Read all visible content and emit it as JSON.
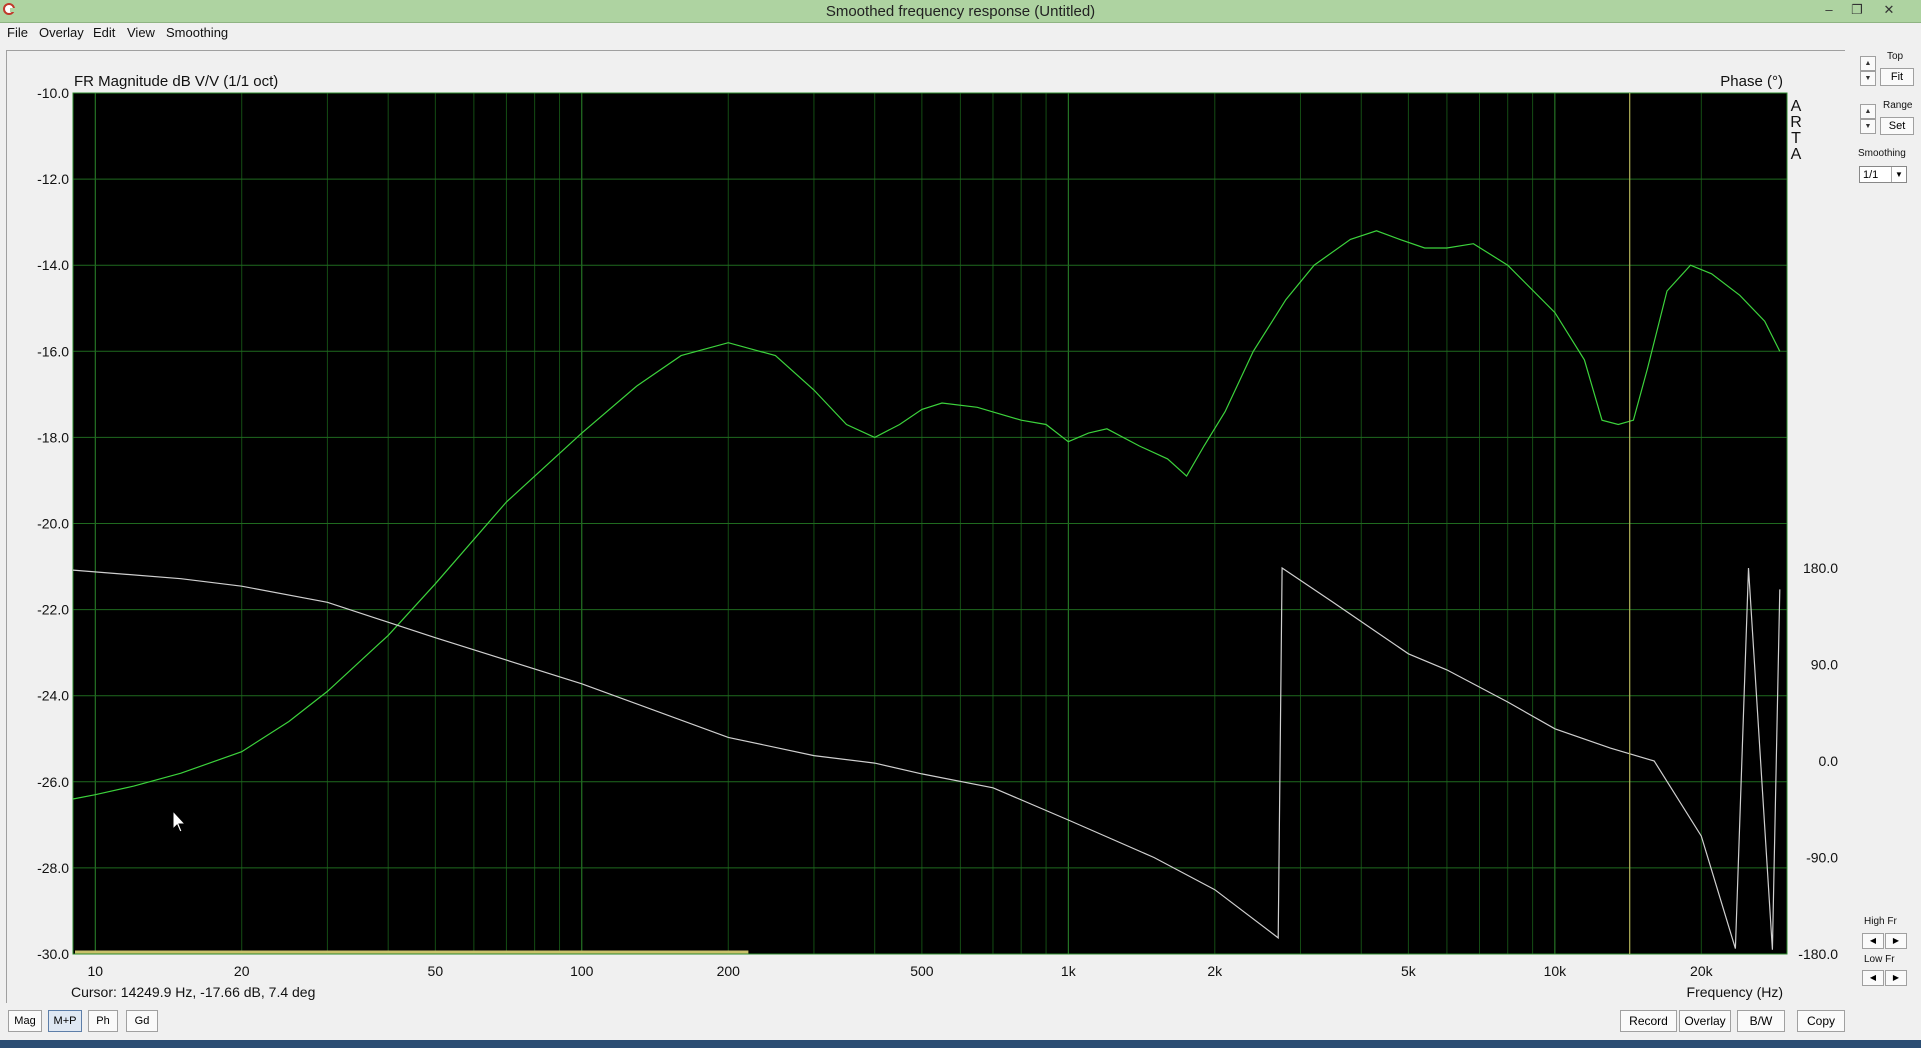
{
  "window": {
    "title": "Smoothed frequency response (Untitled)",
    "controls": [
      "–",
      "❐",
      "✕"
    ]
  },
  "menu": [
    "File",
    "Overlay",
    "Edit",
    "View",
    "Smoothing"
  ],
  "plot": {
    "title_left": "FR Magnitude dB V/V (1/1 oct)",
    "title_right": "Phase (°)",
    "watermark": "ARTA",
    "cursor_readout": "Cursor: 14249.9 Hz, -17.66 dB, 7.4 deg",
    "x_axis_label": "Frequency (Hz)",
    "x_ticks": [
      "10",
      "20",
      "50",
      "100",
      "200",
      "500",
      "1k",
      "2k",
      "5k",
      "10k",
      "20k"
    ],
    "y_ticks": [
      "-10.0",
      "-12.0",
      "-14.0",
      "-16.0",
      "-18.0",
      "-20.0",
      "-22.0",
      "-24.0",
      "-26.0",
      "-28.0",
      "-30.0"
    ],
    "phase_ticks": [
      "180.0",
      "90.0",
      "0.0",
      "-90.0",
      "-180.0"
    ]
  },
  "chart_data": {
    "type": "line",
    "title": "FR Magnitude dB V/V (1/1 oct)",
    "xlabel": "Frequency (Hz)",
    "ylabel": "",
    "x_scale": "log",
    "xlim": [
      9,
      30000
    ],
    "ylim": [
      -30,
      -10
    ],
    "y2lim": [
      -180,
      180
    ],
    "grid": true,
    "cursor": {
      "freq_hz": 14249.9,
      "mag_db": -17.66,
      "phase_deg": 7.4
    },
    "range_marker_hz": [
      9,
      220
    ],
    "series": [
      {
        "axis": "magnitude",
        "color": "#3cd23c",
        "points": [
          [
            9,
            -26.4
          ],
          [
            10,
            -26.3
          ],
          [
            12,
            -26.1
          ],
          [
            15,
            -25.8
          ],
          [
            20,
            -25.3
          ],
          [
            25,
            -24.6
          ],
          [
            30,
            -23.9
          ],
          [
            40,
            -22.6
          ],
          [
            50,
            -21.4
          ],
          [
            70,
            -19.5
          ],
          [
            100,
            -17.9
          ],
          [
            130,
            -16.8
          ],
          [
            160,
            -16.1
          ],
          [
            200,
            -15.8
          ],
          [
            250,
            -16.1
          ],
          [
            300,
            -16.9
          ],
          [
            350,
            -17.7
          ],
          [
            400,
            -18.0
          ],
          [
            450,
            -17.7
          ],
          [
            500,
            -17.35
          ],
          [
            550,
            -17.2
          ],
          [
            650,
            -17.3
          ],
          [
            800,
            -17.6
          ],
          [
            900,
            -17.7
          ],
          [
            1000,
            -18.1
          ],
          [
            1100,
            -17.9
          ],
          [
            1200,
            -17.8
          ],
          [
            1400,
            -18.2
          ],
          [
            1600,
            -18.5
          ],
          [
            1750,
            -18.9
          ],
          [
            1900,
            -18.2
          ],
          [
            2100,
            -17.4
          ],
          [
            2400,
            -16.0
          ],
          [
            2800,
            -14.8
          ],
          [
            3200,
            -14.0
          ],
          [
            3800,
            -13.4
          ],
          [
            4300,
            -13.2
          ],
          [
            4800,
            -13.4
          ],
          [
            5400,
            -13.6
          ],
          [
            6000,
            -13.6
          ],
          [
            6800,
            -13.5
          ],
          [
            8000,
            -14.0
          ],
          [
            10000,
            -15.1
          ],
          [
            11500,
            -16.2
          ],
          [
            12500,
            -17.6
          ],
          [
            13500,
            -17.7
          ],
          [
            14500,
            -17.6
          ],
          [
            15500,
            -16.4
          ],
          [
            17000,
            -14.6
          ],
          [
            19000,
            -14.0
          ],
          [
            21000,
            -14.2
          ],
          [
            24000,
            -14.7
          ],
          [
            27000,
            -15.3
          ],
          [
            29000,
            -16.0
          ]
        ]
      },
      {
        "axis": "phase",
        "color": "#cfcfcf",
        "points": [
          [
            9,
            178
          ],
          [
            15,
            170
          ],
          [
            20,
            163
          ],
          [
            30,
            148
          ],
          [
            50,
            115
          ],
          [
            100,
            72
          ],
          [
            200,
            22
          ],
          [
            300,
            5
          ],
          [
            400,
            -2
          ],
          [
            500,
            -12
          ],
          [
            700,
            -25
          ],
          [
            1000,
            -55
          ],
          [
            1500,
            -90
          ],
          [
            2000,
            -120
          ],
          [
            2700,
            -165
          ],
          [
            2750,
            180
          ],
          [
            3500,
            148
          ],
          [
            5000,
            100
          ],
          [
            6000,
            85
          ],
          [
            8000,
            55
          ],
          [
            10000,
            30
          ],
          [
            13000,
            12
          ],
          [
            16000,
            0
          ],
          [
            20000,
            -70
          ],
          [
            23500,
            -175
          ],
          [
            25000,
            180
          ],
          [
            28000,
            -176
          ],
          [
            29000,
            160
          ]
        ]
      }
    ]
  },
  "right_panel": {
    "top_label": "Top",
    "fit_label": "Fit",
    "range_label": "Range",
    "set_label": "Set",
    "smoothing_label": "Smoothing",
    "smoothing_value": "1/1",
    "high_fr_label": "High Fr",
    "low_fr_label": "Low Fr"
  },
  "bottom_bar": {
    "tabs": [
      "Mag",
      "M+P",
      "Ph",
      "Gd"
    ],
    "active_tab": "M+P",
    "actions": [
      "Record",
      "Overlay",
      "B/W",
      "Copy"
    ]
  }
}
